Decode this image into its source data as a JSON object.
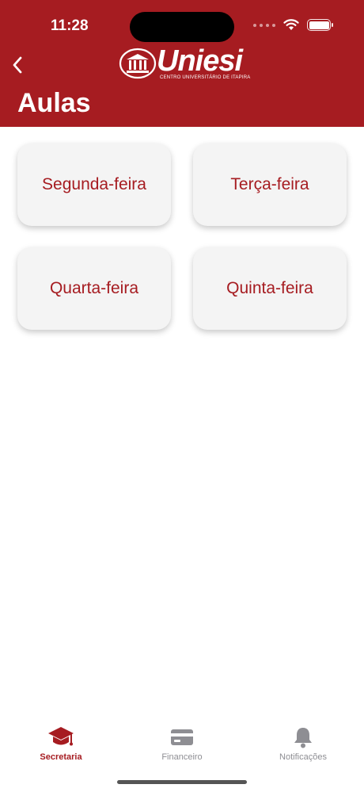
{
  "status_bar": {
    "time": "11:28"
  },
  "header": {
    "logo_text": "Uniesi",
    "logo_subtitle": "CENTRO UNIVERSITÁRIO DE ITAPIRA",
    "title": "Aulas",
    "back_icon": "chevron-left-icon"
  },
  "days": [
    {
      "label": "Segunda-feira"
    },
    {
      "label": "Terça-feira"
    },
    {
      "label": "Quarta-feira"
    },
    {
      "label": "Quinta-feira"
    }
  ],
  "tabbar": {
    "items": [
      {
        "label": "Secretaria",
        "icon": "graduation-cap-icon",
        "active": true
      },
      {
        "label": "Financeiro",
        "icon": "credit-card-icon",
        "active": false
      },
      {
        "label": "Notificações",
        "icon": "bell-icon",
        "active": false
      }
    ]
  },
  "colors": {
    "brand": "#a61c21",
    "card_bg": "#f4f4f4",
    "inactive": "#8e8e93"
  }
}
